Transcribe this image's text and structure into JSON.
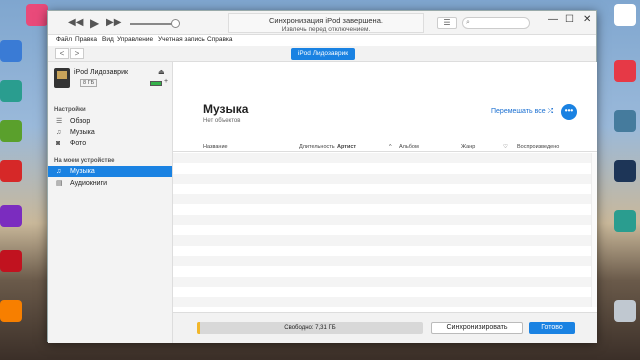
{
  "window": {
    "lcd_line1": "Синхронизация iPod завершена.",
    "lcd_line2": "Извлечь перед отключением.",
    "search_placeholder": "",
    "minimize": "—",
    "maximize": "☐",
    "close": "✕"
  },
  "menu": [
    "Файл",
    "Правка",
    "Вид",
    "Управление",
    "Учетная запись",
    "Справка"
  ],
  "navbar": {
    "back": "<",
    "forward": ">",
    "device_button": "iPod Лидозаврик"
  },
  "sidebar": {
    "device_name": "iPod Лидозаврик",
    "capacity": "8 ГБ",
    "settings_header": "Настройки",
    "settings_items": [
      "Обзор",
      "Музыка",
      "Фото"
    ],
    "on_device_header": "На моем устройстве",
    "device_items": [
      "Музыка",
      "Аудиокниги"
    ]
  },
  "main": {
    "title": "Музыка",
    "subtitle": "Нет объектов",
    "shuffle_label": "Перемешать все",
    "more_label": "•••",
    "columns": [
      "Название",
      "Длительность",
      "Артист",
      "Альбом",
      "Жанр",
      "♡",
      "Воспроизведено"
    ]
  },
  "footer": {
    "storage_label": "Свободно: 7,31 ГБ",
    "storage_used_fraction": 0.015,
    "sync_button": "Синхронизировать",
    "done_button": "Готово"
  },
  "colors": {
    "accent": "#1a82e2",
    "storage_fill": "#f2b72b"
  },
  "icons": {
    "prev": "rewind-icon",
    "play": "play-icon",
    "next": "fast-forward-icon",
    "eject": "eject-icon",
    "shuffle": "shuffle-icon"
  }
}
